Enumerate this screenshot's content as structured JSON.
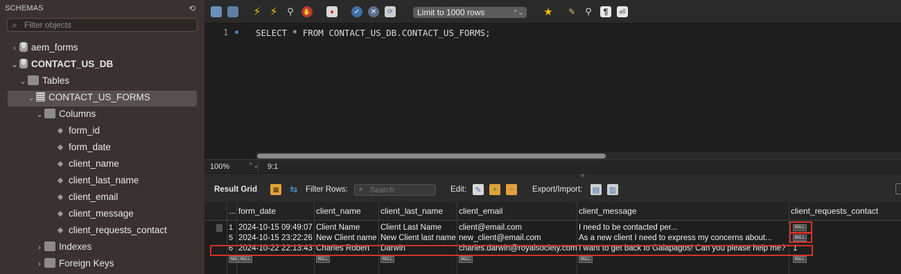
{
  "sidebar": {
    "header": "SCHEMAS",
    "filter_placeholder": "Filter objects",
    "tree": {
      "schema1": "aem_forms",
      "schema2": "CONTACT_US_DB",
      "tables_folder": "Tables",
      "table": "CONTACT_US_FORMS",
      "columns_folder": "Columns",
      "columns": [
        "form_id",
        "form_date",
        "client_name",
        "client_last_name",
        "client_email",
        "client_message",
        "client_requests_contact"
      ],
      "indexes_folder": "Indexes",
      "foreign_keys_folder": "Foreign Keys"
    }
  },
  "toolbar": {
    "limit_label": "Limit to 1000 rows"
  },
  "editor": {
    "line_number": "1",
    "sql": "SELECT * FROM CONTACT_US_DB.CONTACT_US_FORMS;"
  },
  "status": {
    "zoom": "100%",
    "cursor_position": "9:1"
  },
  "result_toolbar": {
    "result_grid_label": "Result Grid",
    "filter_rows_label": "Filter Rows:",
    "search_placeholder": "Search",
    "edit_label": "Edit:",
    "export_import_label": "Export/Import:"
  },
  "grid": {
    "row_header": "...",
    "columns": [
      "form_date",
      "client_name",
      "client_last_name",
      "client_email",
      "client_message",
      "client_requests_contact"
    ],
    "null_text": "NULL",
    "rows": [
      {
        "num": "1",
        "form_date": "2024-10-15 09:49:07",
        "client_name": "Client Name",
        "client_last_name": "Client Last Name",
        "client_email": "client@email.com",
        "client_message": "I need to be contacted per...",
        "client_requests_contact": "NULL"
      },
      {
        "num": "5",
        "form_date": "2024-10-15 23:22:26",
        "client_name": "New Client name",
        "client_last_name": "New Client last name",
        "client_email": "new_client@email.com",
        "client_message": "As a new client I need to express my concerns about...",
        "client_requests_contact": "NULL"
      },
      {
        "num": "6",
        "form_date": "2024-10-22 22:13:43",
        "client_name": "Charles Robert",
        "client_last_name": "Darwin",
        "client_email": "charles.darwin@royalsociety.com",
        "client_message": "I want to get back to Galapagos! Can you please help me?",
        "client_requests_contact": "1"
      }
    ]
  }
}
